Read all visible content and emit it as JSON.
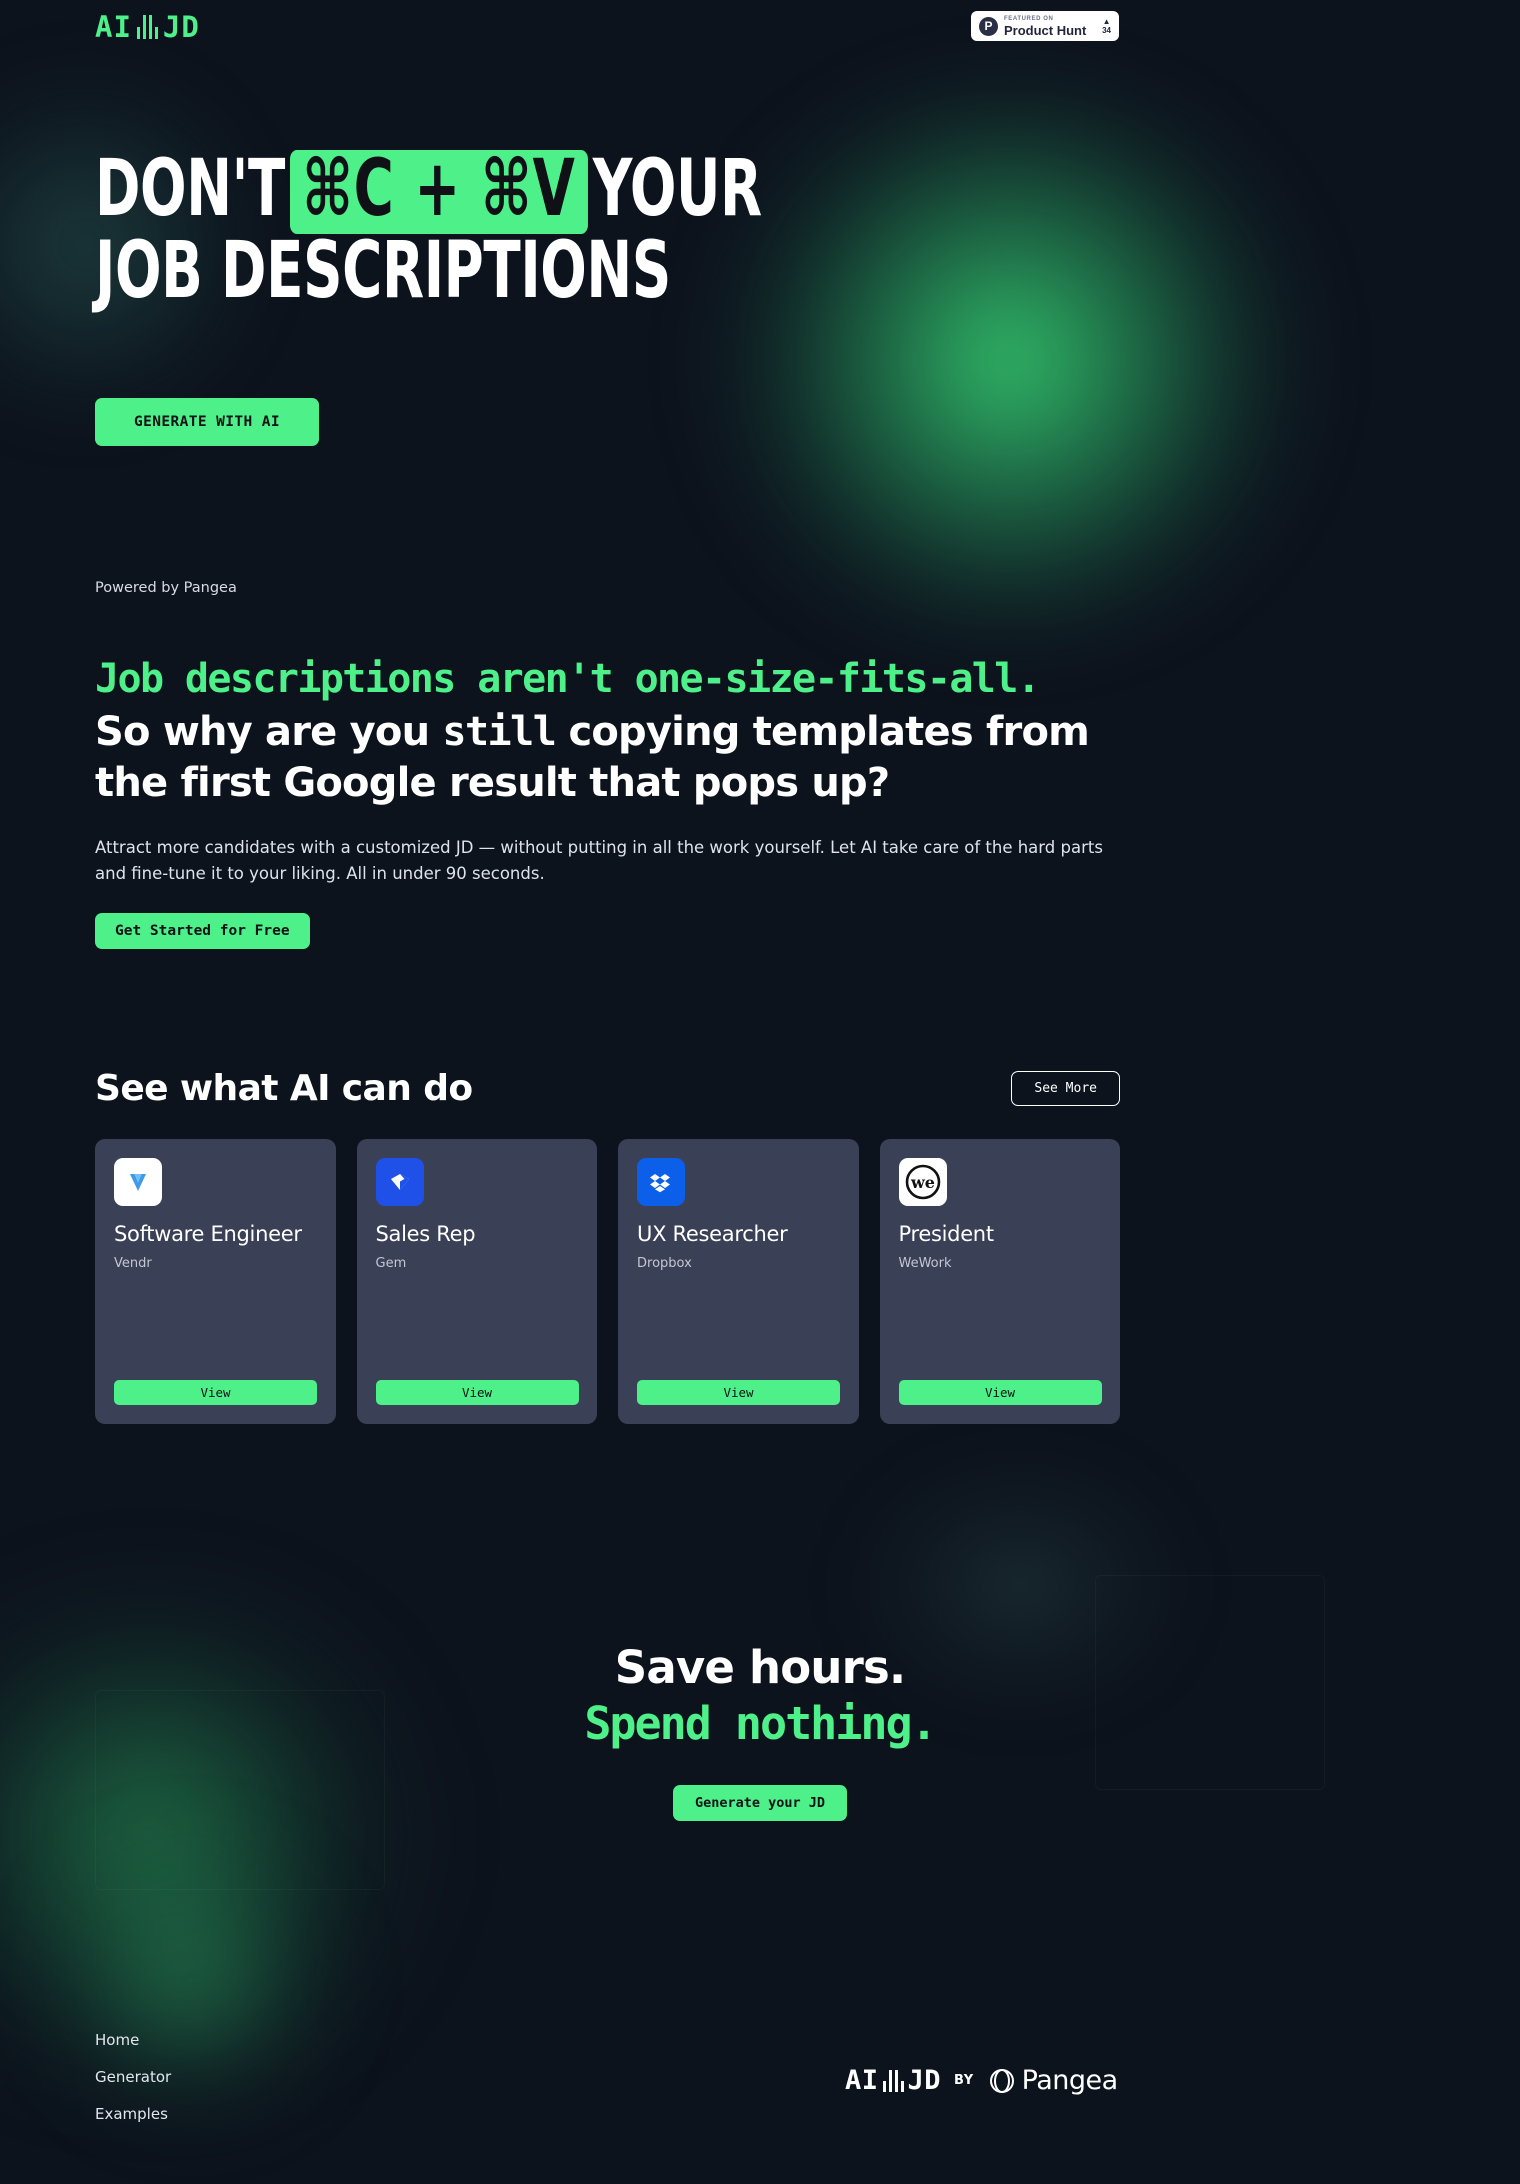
{
  "brand": {
    "logo_left": "AI",
    "logo_right": "JD",
    "accent_color": "#4ef08a",
    "background_color": "#0d131d",
    "card_color": "#3a4055"
  },
  "header": {
    "product_hunt": {
      "eyebrow": "FEATURED ON",
      "name": "Product Hunt",
      "caret": "▲",
      "votes": "34"
    }
  },
  "hero": {
    "line1_before": "DON'T",
    "kbd_chip": "⌘C + ⌘V",
    "line1_after": "YOUR",
    "line2": "JOB DESCRIPTIONS",
    "cta_label": "GENERATE WITH AI",
    "powered_by": "Powered by Pangea"
  },
  "pitch": {
    "headline_green": "Job descriptions aren't one-size-fits-all.",
    "headline_white_part1": "So why are you",
    "headline_white_emphasis": "still",
    "headline_white_part2": "copying templates from the first Google result that pops up?",
    "body": "Attract more candidates with a customized JD — without putting in all the work yourself. Let AI take care of the hard parts and fine-tune it to your liking. All in under 90 seconds.",
    "cta_label": "Get Started for Free"
  },
  "examples": {
    "title": "See what AI can do",
    "see_more_label": "See More",
    "cards": [
      {
        "title": "Software Engineer",
        "company": "Vendr",
        "logo": "vendr-logo",
        "view_label": "View"
      },
      {
        "title": "Sales Rep",
        "company": "Gem",
        "logo": "gem-logo",
        "view_label": "View"
      },
      {
        "title": "UX Researcher",
        "company": "Dropbox",
        "logo": "dropbox-logo",
        "view_label": "View"
      },
      {
        "title": "President",
        "company": "WeWork",
        "logo": "wework-logo",
        "view_label": "View"
      }
    ]
  },
  "cta": {
    "line1": "Save hours.",
    "line2": "Spend nothing.",
    "button_label": "Generate your JD"
  },
  "footer": {
    "links": [
      {
        "label": "Home"
      },
      {
        "label": "Generator"
      },
      {
        "label": "Examples"
      }
    ],
    "brand_left": "AI",
    "brand_right": "JD",
    "by_label": "BY",
    "partner": "Pangea"
  }
}
